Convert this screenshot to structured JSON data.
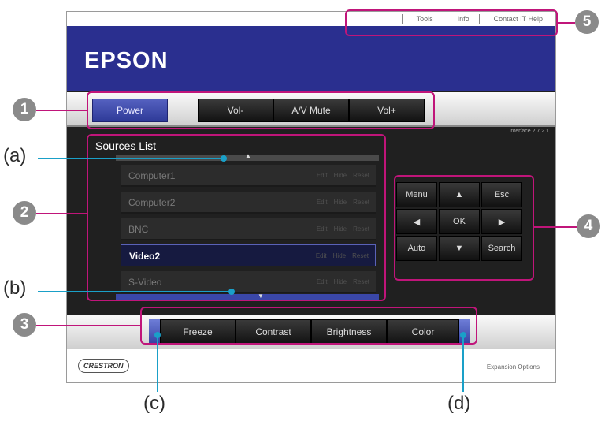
{
  "header": {
    "links": [
      "Tools",
      "Info",
      "Contact IT Help"
    ],
    "brand": "EPSON"
  },
  "power_bar": {
    "power": "Power",
    "vol_down": "Vol-",
    "av_mute": "A/V Mute",
    "vol_up": "Vol+"
  },
  "version": "Interface 2.7.2.1",
  "sources": {
    "title": "Sources List",
    "items": [
      {
        "name": "Computer1",
        "edit": "Edit",
        "hide": "Hide",
        "reset": "Reset"
      },
      {
        "name": "Computer2",
        "edit": "Edit",
        "hide": "Hide",
        "reset": "Reset"
      },
      {
        "name": "BNC",
        "edit": "Edit",
        "hide": "Hide",
        "reset": "Reset"
      },
      {
        "name": "Video2",
        "edit": "Edit",
        "hide": "Hide",
        "reset": "Reset"
      },
      {
        "name": "S-Video",
        "edit": "Edit",
        "hide": "Hide",
        "reset": "Reset"
      }
    ],
    "selected": "Video2"
  },
  "arrow_pad": {
    "menu": "Menu",
    "esc": "Esc",
    "ok": "OK",
    "auto": "Auto",
    "search": "Search"
  },
  "function_bar": {
    "freeze": "Freeze",
    "contrast": "Contrast",
    "brightness": "Brightness",
    "color": "Color"
  },
  "footer": {
    "crestron": "CRESTRON",
    "expansion": "Expansion Options"
  },
  "callouts": {
    "numbers": [
      "1",
      "2",
      "3",
      "4",
      "5"
    ],
    "letters": [
      "(a)",
      "(b)",
      "(c)",
      "(d)"
    ]
  },
  "colors": {
    "banner": "#2a2f8f",
    "callout_magenta": "#c0157a",
    "callout_cyan": "#1aa0c8"
  }
}
